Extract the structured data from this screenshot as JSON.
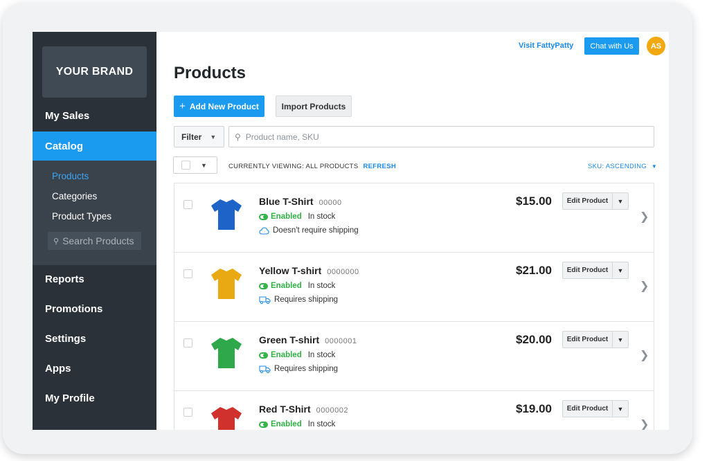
{
  "brand": "YOUR BRAND",
  "sidebar": {
    "items": [
      {
        "label": "My Sales"
      },
      {
        "label": "Catalog"
      },
      {
        "label": "Reports"
      },
      {
        "label": "Promotions"
      },
      {
        "label": "Settings"
      },
      {
        "label": "Apps"
      },
      {
        "label": "My Profile"
      }
    ],
    "subitems": [
      {
        "label": "Products"
      },
      {
        "label": "Categories"
      },
      {
        "label": "Product Types"
      }
    ],
    "search_placeholder": "Search Products"
  },
  "header": {
    "visit_link": "Visit FattyPatty",
    "chat_button": "Chat with Us",
    "avatar_initials": "AS"
  },
  "main": {
    "title": "Products",
    "add_button": "Add New Product",
    "import_button": "Import Products",
    "filter_label": "Filter",
    "search_placeholder": "Product name, SKU",
    "viewing_label": "CURRENTLY VIEWING: ALL PRODUCTS",
    "refresh_label": "REFRESH",
    "sort_label": "SKU: ASCENDING",
    "edit_label": "Edit Product"
  },
  "products": [
    {
      "name": "Blue T-Shirt",
      "sku": "00000",
      "status": "Enabled",
      "stock": "In stock",
      "shipping": "Doesn't require shipping",
      "shipping_icon": "cloud-icon",
      "price": "$15.00",
      "color": "#1e63c8"
    },
    {
      "name": "Yellow T-shirt",
      "sku": "0000000",
      "status": "Enabled",
      "stock": "In stock",
      "shipping": "Requires shipping",
      "shipping_icon": "truck-icon",
      "price": "$21.00",
      "color": "#e8a912"
    },
    {
      "name": "Green T-shirt",
      "sku": "0000001",
      "status": "Enabled",
      "stock": "In stock",
      "shipping": "Requires shipping",
      "shipping_icon": "truck-icon",
      "price": "$20.00",
      "color": "#2ea84a"
    },
    {
      "name": "Red T-Shirt",
      "sku": "0000002",
      "status": "Enabled",
      "stock": "In stock",
      "shipping": "",
      "shipping_icon": "",
      "price": "$19.00",
      "color": "#d0312d"
    }
  ],
  "colors": {
    "accent": "#1a9bf0",
    "sidebar": "#2a3138",
    "enabled": "#2fb344"
  }
}
